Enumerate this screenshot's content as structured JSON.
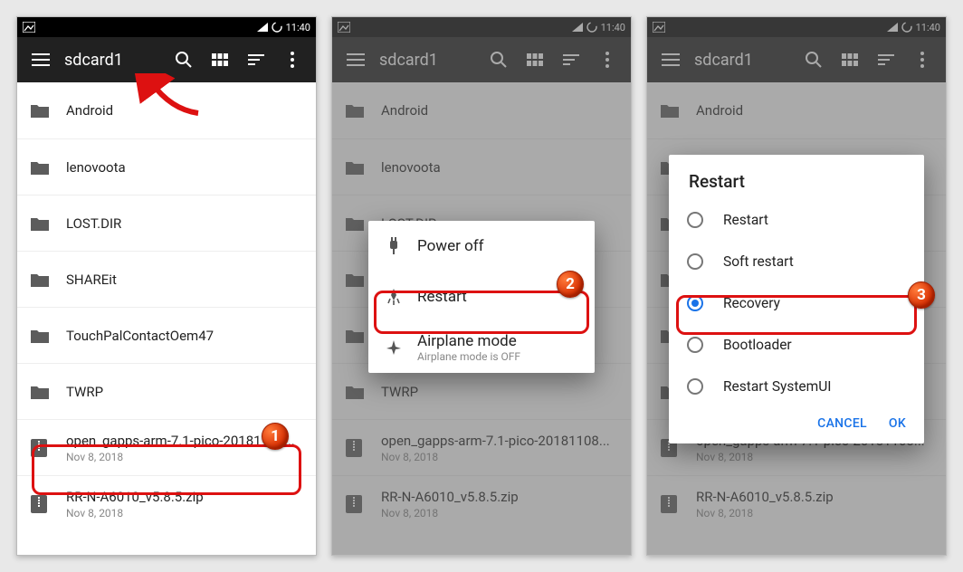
{
  "status": {
    "time": "11:40"
  },
  "toolbar": {
    "title": "sdcard1"
  },
  "files": [
    {
      "name": "Android",
      "type": "folder"
    },
    {
      "name": "lenovoota",
      "type": "folder"
    },
    {
      "name": "LOST.DIR",
      "type": "folder"
    },
    {
      "name": "SHAREit",
      "type": "folder"
    },
    {
      "name": "TouchPalContactOem47",
      "type": "folder"
    },
    {
      "name": "TWRP",
      "type": "folder"
    },
    {
      "name": "open_gapps-arm-7.1-pico-20181108...",
      "type": "zip",
      "sub": "Nov 8, 2018"
    },
    {
      "name": "RR-N-A6010_v5.8.5.zip",
      "type": "zip",
      "sub": "Nov 8, 2018"
    }
  ],
  "power_menu": {
    "items": [
      {
        "icon": "plug",
        "label": "Power off"
      },
      {
        "icon": "rocket",
        "label": "Restart"
      },
      {
        "icon": "plane",
        "label": "Airplane mode",
        "sub": "Airplane mode is OFF"
      }
    ]
  },
  "restart_dialog": {
    "title": "Restart",
    "options": [
      "Restart",
      "Soft restart",
      "Recovery",
      "Bootloader",
      "Restart SystemUI"
    ],
    "selected_index": 2,
    "actions": {
      "cancel": "CANCEL",
      "ok": "OK"
    }
  },
  "badges": {
    "b1": "1",
    "b2": "2",
    "b3": "3"
  },
  "colors": {
    "accent": "#1a73e8",
    "callout": "#d11",
    "toolbar": "#212121"
  }
}
